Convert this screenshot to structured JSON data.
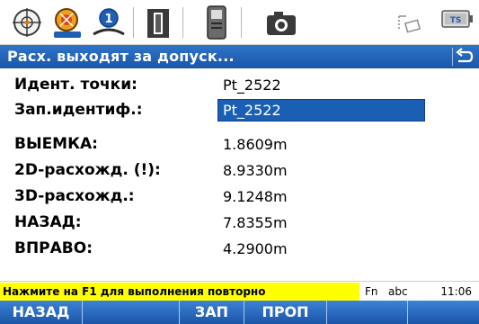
{
  "statusbar": {
    "icons": [
      "target-icon",
      "prism-icon",
      "reflectorless-icon",
      "instrument-icon",
      "controller-icon",
      "camera-icon",
      "staking-icon",
      "battery-icon"
    ],
    "battery_label": "TS"
  },
  "title": {
    "text": "Расх. выходят за допуск...",
    "back_icon": "return-icon"
  },
  "fields": {
    "point_id": {
      "label": "Идент. точки:",
      "value": "Pt_2522"
    },
    "record_id": {
      "label": "Зап.идентиф.:",
      "value": "Pt_2522"
    },
    "cut": {
      "label": "ВЫЕМКА:",
      "value": "1.8609m"
    },
    "delta_2d": {
      "label": "2D-расхожд. (!):",
      "value": "8.9330m"
    },
    "delta_3d": {
      "label": "3D-расхожд.:",
      "value": "9.1248m"
    },
    "back": {
      "label": "НАЗАД:",
      "value": "7.8355m"
    },
    "right": {
      "label": "ВПРАВО:",
      "value": "4.2900m"
    }
  },
  "message": {
    "text": "Нажмите на F1 для выполнения повторно",
    "fn": "Fn",
    "input_mode": "abc",
    "time": "11:06"
  },
  "softkeys": [
    "НАЗАД",
    "",
    "ЗАП",
    "ПРОП",
    "",
    ""
  ],
  "colors": {
    "title_bar": "#1f5fb4",
    "selection": "#1b5fb4",
    "message_highlight": "#ffff00",
    "softkey_bar": "#2a6cc2"
  }
}
